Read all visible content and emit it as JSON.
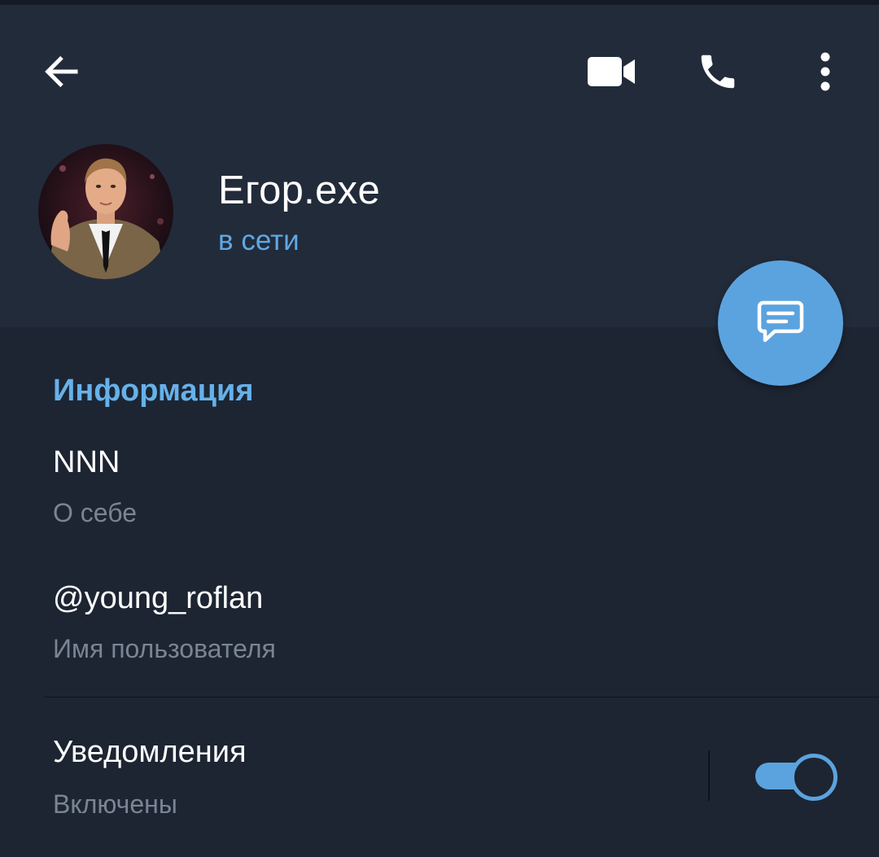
{
  "header": {
    "back_icon": "arrow-left-icon",
    "video_call_icon": "video-camera-icon",
    "call_icon": "phone-icon",
    "more_icon": "more-vertical-icon"
  },
  "profile": {
    "name": "Егор.exe",
    "status": "в сети",
    "avatar_icon": "user-photo",
    "status_color": "#5fa8e4"
  },
  "fab": {
    "icon": "message-icon",
    "color": "#5ba3df"
  },
  "info": {
    "title": "Информация",
    "about": {
      "value": "NNN",
      "caption": "О себе"
    },
    "username": {
      "value": "@young_roflan",
      "caption": "Имя пользователя"
    }
  },
  "notifications": {
    "title": "Уведомления",
    "status": "Включены",
    "enabled": true
  },
  "colors": {
    "background": "#1d2532",
    "header": "#222b3a",
    "accent": "#5ba3df",
    "section_title": "#66b1ea",
    "secondary_text": "#7a8593"
  }
}
